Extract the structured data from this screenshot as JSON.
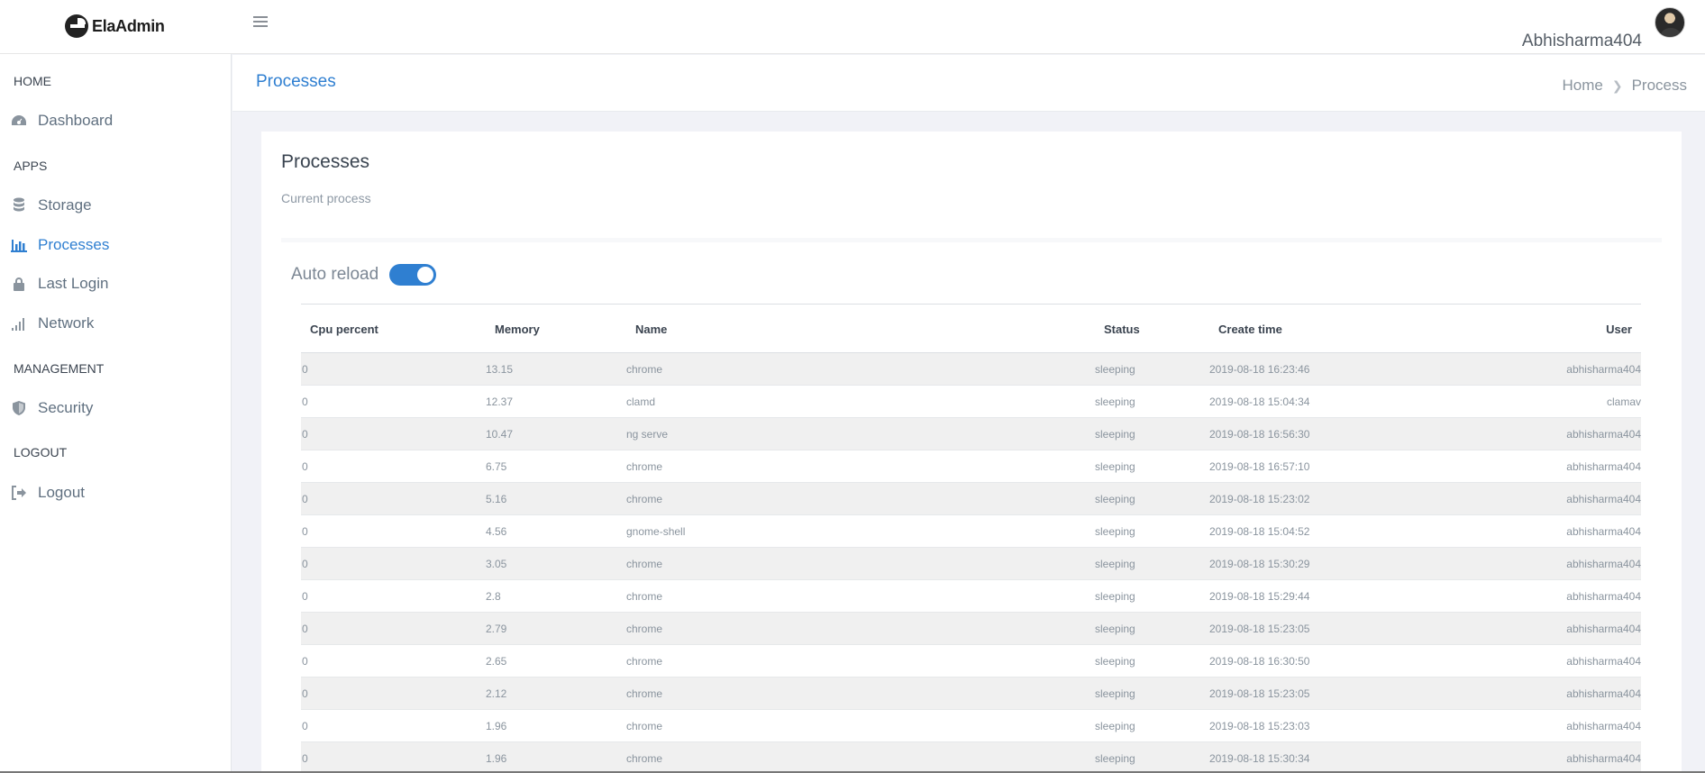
{
  "header": {
    "logo_text": "ElaAdmin",
    "username": "Abhisharma404"
  },
  "sidebar": {
    "sections": [
      {
        "label": "HOME"
      },
      {
        "label": "APPS"
      },
      {
        "label": "MANAGEMENT"
      },
      {
        "label": "LOGOUT"
      }
    ],
    "items": [
      {
        "label": "Dashboard",
        "icon": "dashboard-icon"
      },
      {
        "label": "Storage",
        "icon": "database-icon"
      },
      {
        "label": "Processes",
        "icon": "bar-chart-icon",
        "active": true
      },
      {
        "label": "Last Login",
        "icon": "lock-icon"
      },
      {
        "label": "Network",
        "icon": "signal-icon"
      },
      {
        "label": "Security",
        "icon": "shield-icon"
      },
      {
        "label": "Logout",
        "icon": "sign-out-icon"
      }
    ]
  },
  "titlebar": {
    "title": "Processes",
    "breadcrumb": [
      "Home",
      "Process"
    ]
  },
  "card": {
    "title": "Processes",
    "subtitle": "Current process",
    "auto_reload_label": "Auto reload",
    "auto_reload_on": true
  },
  "table": {
    "columns": [
      "Cpu percent",
      "Memory",
      "Name",
      "Status",
      "Create time",
      "User"
    ],
    "rows": [
      {
        "cpu": "0",
        "memory": "13.15",
        "name": "chrome",
        "status": "sleeping",
        "create_time": "2019-08-18 16:23:46",
        "user": "abhisharma404"
      },
      {
        "cpu": "0",
        "memory": "12.37",
        "name": "clamd",
        "status": "sleeping",
        "create_time": "2019-08-18 15:04:34",
        "user": "clamav"
      },
      {
        "cpu": "0",
        "memory": "10.47",
        "name": "ng serve",
        "status": "sleeping",
        "create_time": "2019-08-18 16:56:30",
        "user": "abhisharma404"
      },
      {
        "cpu": "0",
        "memory": "6.75",
        "name": "chrome",
        "status": "sleeping",
        "create_time": "2019-08-18 16:57:10",
        "user": "abhisharma404"
      },
      {
        "cpu": "0",
        "memory": "5.16",
        "name": "chrome",
        "status": "sleeping",
        "create_time": "2019-08-18 15:23:02",
        "user": "abhisharma404"
      },
      {
        "cpu": "0",
        "memory": "4.56",
        "name": "gnome-shell",
        "status": "sleeping",
        "create_time": "2019-08-18 15:04:52",
        "user": "abhisharma404"
      },
      {
        "cpu": "0",
        "memory": "3.05",
        "name": "chrome",
        "status": "sleeping",
        "create_time": "2019-08-18 15:30:29",
        "user": "abhisharma404"
      },
      {
        "cpu": "0",
        "memory": "2.8",
        "name": "chrome",
        "status": "sleeping",
        "create_time": "2019-08-18 15:29:44",
        "user": "abhisharma404"
      },
      {
        "cpu": "0",
        "memory": "2.79",
        "name": "chrome",
        "status": "sleeping",
        "create_time": "2019-08-18 15:23:05",
        "user": "abhisharma404"
      },
      {
        "cpu": "0",
        "memory": "2.65",
        "name": "chrome",
        "status": "sleeping",
        "create_time": "2019-08-18 16:30:50",
        "user": "abhisharma404"
      },
      {
        "cpu": "0",
        "memory": "2.12",
        "name": "chrome",
        "status": "sleeping",
        "create_time": "2019-08-18 15:23:05",
        "user": "abhisharma404"
      },
      {
        "cpu": "0",
        "memory": "1.96",
        "name": "chrome",
        "status": "sleeping",
        "create_time": "2019-08-18 15:23:03",
        "user": "abhisharma404"
      },
      {
        "cpu": "0",
        "memory": "1.96",
        "name": "chrome",
        "status": "sleeping",
        "create_time": "2019-08-18 15:30:34",
        "user": "abhisharma404"
      }
    ]
  },
  "colors": {
    "accent": "#2f7fd1",
    "sidebar_bg": "#ffffff",
    "page_bg": "#f1f2f7",
    "row_stripe": "#f0f0f0"
  }
}
